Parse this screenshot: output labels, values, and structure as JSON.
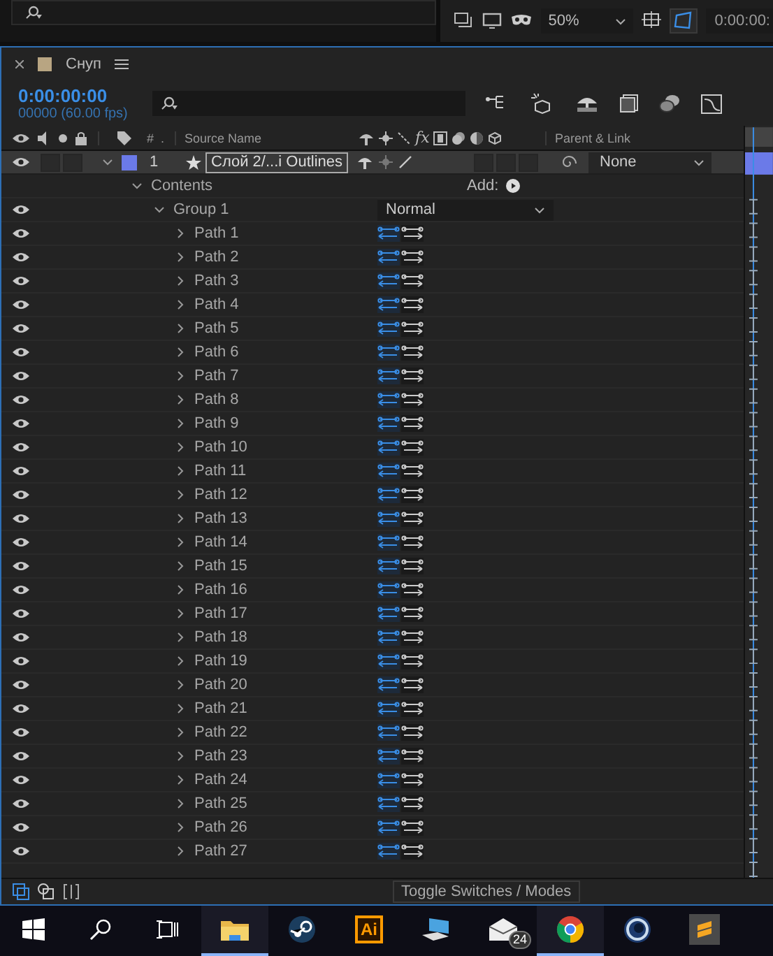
{
  "viewer_bar": {
    "zoom": "50%",
    "timecode": "0:00:00:"
  },
  "panel": {
    "title": "Снуп",
    "timecode": "0:00:00:00",
    "frame_info": "00000 (60.00 fps)"
  },
  "columns": {
    "number": "#",
    "dot": ".",
    "source_name": "Source Name",
    "effects": "fx",
    "parent": "Parent & Link"
  },
  "layer": {
    "number": "1",
    "name": "Слой 2/...i Outlines",
    "expanded": true,
    "visible": true,
    "color": "#6b7ae8",
    "parent": "None"
  },
  "contents": {
    "label": "Contents",
    "add_label": "Add:",
    "expanded": true
  },
  "group": {
    "name": "Group 1",
    "expanded": true,
    "visible": true,
    "blend_mode": "Normal"
  },
  "paths": [
    {
      "name": "Path 1",
      "expanded": false
    },
    {
      "name": "Path 2",
      "expanded": false
    },
    {
      "name": "Path 3",
      "expanded": false
    },
    {
      "name": "Path 4",
      "expanded": false
    },
    {
      "name": "Path 5",
      "expanded": false
    },
    {
      "name": "Path 6",
      "expanded": false
    },
    {
      "name": "Path 7",
      "expanded": false
    },
    {
      "name": "Path 8",
      "expanded": false
    },
    {
      "name": "Path 9",
      "expanded": false
    },
    {
      "name": "Path 10",
      "expanded": false
    },
    {
      "name": "Path 11",
      "expanded": false
    },
    {
      "name": "Path 12",
      "expanded": false
    },
    {
      "name": "Path 13",
      "expanded": false
    },
    {
      "name": "Path 14",
      "expanded": false
    },
    {
      "name": "Path 15",
      "expanded": false
    },
    {
      "name": "Path 16",
      "expanded": false
    },
    {
      "name": "Path 17",
      "expanded": false
    },
    {
      "name": "Path 18",
      "expanded": false
    },
    {
      "name": "Path 19",
      "expanded": false
    },
    {
      "name": "Path 20",
      "expanded": false
    },
    {
      "name": "Path 21",
      "expanded": false
    },
    {
      "name": "Path 22",
      "expanded": false
    },
    {
      "name": "Path 23",
      "expanded": false
    },
    {
      "name": "Path 24",
      "expanded": false
    },
    {
      "name": "Path 25",
      "expanded": false
    },
    {
      "name": "Path 26",
      "expanded": false
    },
    {
      "name": "Path 27",
      "expanded": false
    }
  ],
  "footer": {
    "toggle_label": "Toggle Switches / Modes"
  },
  "taskbar": {
    "apps": [
      {
        "kind": "start",
        "running": false
      },
      {
        "kind": "search",
        "running": false
      },
      {
        "kind": "task-view",
        "running": false
      },
      {
        "kind": "folder",
        "running": true
      },
      {
        "kind": "steam",
        "running": false
      },
      {
        "kind": "illustrator",
        "running": false,
        "label": "Ai"
      },
      {
        "kind": "computer",
        "running": false
      },
      {
        "kind": "mail",
        "running": false,
        "badge": "24"
      },
      {
        "kind": "chrome",
        "running": true
      },
      {
        "kind": "cinema",
        "running": false
      },
      {
        "kind": "sublime",
        "running": false
      }
    ]
  }
}
